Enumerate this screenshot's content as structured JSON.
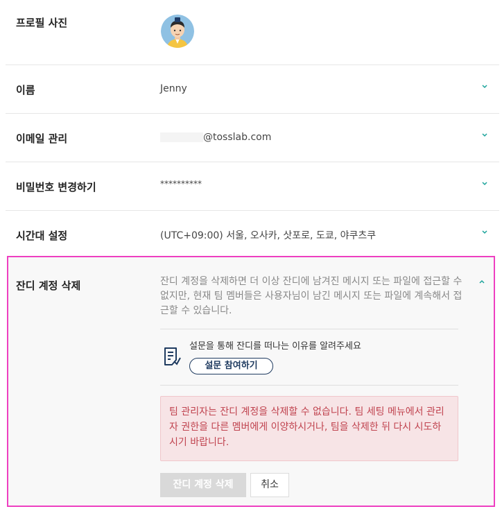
{
  "profile_photo": {
    "label": "프로필 사진"
  },
  "name": {
    "label": "이름",
    "value": "Jenny"
  },
  "email": {
    "label": "이메일 관리",
    "value": "@tosslab.com"
  },
  "password": {
    "label": "비밀번호 변경하기",
    "value": "**********"
  },
  "timezone": {
    "label": "시간대 설정",
    "value": "(UTC+09:00) 서울, 오사카, 삿포로, 도쿄, 야쿠츠쿠"
  },
  "delete_account": {
    "label": "잔디 계정 삭제",
    "description": "잔디 계정을 삭제하면 더 이상 잔디에 남겨진 메시지 또는 파일에 접근할 수 없지만, 현재 팀 멤버들은 사용자님이 남긴 메시지 또는 파일에 계속해서 접근할 수 있습니다.",
    "survey_text": "설문을 통해 잔디를 떠나는 이유를 알려주세요",
    "survey_button": "설문 참여하기",
    "warning": "팀 관리자는 잔디 계정을 삭제할 수 없습니다. 팀 세팅 메뉴에서 관리자 권한을 다른 멤버에게 이양하시거나, 팀을 삭제한 뒤 다시 시도하시기 바랍니다.",
    "delete_button": "잔디 계정 삭제",
    "cancel_button": "취소"
  },
  "colors": {
    "accent": "#1aa39a",
    "highlight_border": "#ee3fc1",
    "warning_text": "#c0434f",
    "warning_bg": "#f7e4e6"
  },
  "icons": {
    "expand": "chevron-down-icon",
    "collapse": "chevron-up-icon",
    "survey": "survey-document-icon"
  }
}
